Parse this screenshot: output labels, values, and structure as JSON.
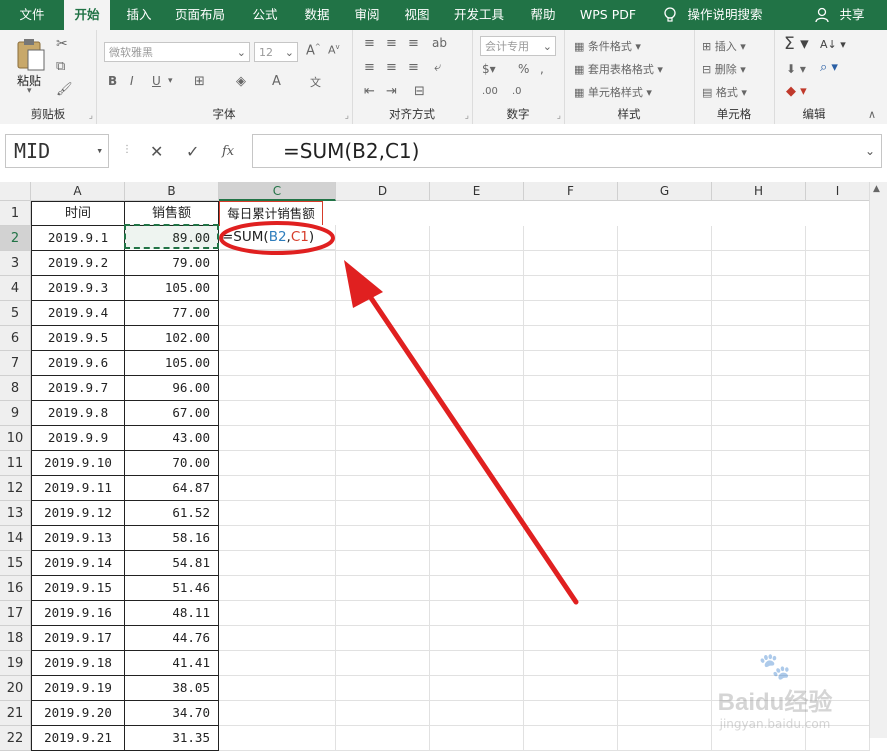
{
  "tabs": [
    {
      "label": "文件"
    },
    {
      "label": "开始",
      "active": true
    },
    {
      "label": "插入"
    },
    {
      "label": "页面布局"
    },
    {
      "label": "公式"
    },
    {
      "label": "数据"
    },
    {
      "label": "审阅"
    },
    {
      "label": "视图"
    },
    {
      "label": "开发工具"
    },
    {
      "label": "帮助"
    },
    {
      "label": "WPS PDF"
    },
    {
      "label": "操作说明搜索"
    }
  ],
  "share_label": "共享",
  "ribbon": {
    "clipboard": {
      "label": "剪贴板",
      "paste_label": "粘贴"
    },
    "font": {
      "label": "字体",
      "font_name": "微软雅黑",
      "font_size": "12",
      "bold": "B",
      "italic": "I",
      "underline": "U",
      "font_color": "A"
    },
    "alignment": {
      "label": "对齐方式"
    },
    "number": {
      "label": "数字",
      "format": "会计专用"
    },
    "styles": {
      "label": "样式",
      "cond_format": "条件格式",
      "table_format": "套用表格格式",
      "cell_style": "单元格样式"
    },
    "cells": {
      "label": "单元格",
      "insert": "插入",
      "delete": "删除",
      "format": "格式"
    },
    "editing": {
      "label": "编辑"
    }
  },
  "formula_bar": {
    "name_box": "MID",
    "formula": "=SUM(B2,C1)",
    "cancel": "✕",
    "confirm": "✓",
    "fx": "fx"
  },
  "columns": [
    "A",
    "B",
    "C",
    "D",
    "E",
    "F",
    "G",
    "H",
    "I"
  ],
  "headers": {
    "a": "时间",
    "b": "销售额",
    "c": "每日累计销售额"
  },
  "rows": [
    {
      "r": "2",
      "a": "2019.9.1",
      "b": "89.00"
    },
    {
      "r": "3",
      "a": "2019.9.2",
      "b": "79.00"
    },
    {
      "r": "4",
      "a": "2019.9.3",
      "b": "105.00"
    },
    {
      "r": "5",
      "a": "2019.9.4",
      "b": "77.00"
    },
    {
      "r": "6",
      "a": "2019.9.5",
      "b": "102.00"
    },
    {
      "r": "7",
      "a": "2019.9.6",
      "b": "105.00"
    },
    {
      "r": "8",
      "a": "2019.9.7",
      "b": "96.00"
    },
    {
      "r": "9",
      "a": "2019.9.8",
      "b": "67.00"
    },
    {
      "r": "10",
      "a": "2019.9.9",
      "b": "43.00"
    },
    {
      "r": "11",
      "a": "2019.9.10",
      "b": "70.00"
    },
    {
      "r": "12",
      "a": "2019.9.11",
      "b": "64.87"
    },
    {
      "r": "13",
      "a": "2019.9.12",
      "b": "61.52"
    },
    {
      "r": "14",
      "a": "2019.9.13",
      "b": "58.16"
    },
    {
      "r": "15",
      "a": "2019.9.14",
      "b": "54.81"
    },
    {
      "r": "16",
      "a": "2019.9.15",
      "b": "51.46"
    },
    {
      "r": "17",
      "a": "2019.9.16",
      "b": "48.11"
    },
    {
      "r": "18",
      "a": "2019.9.17",
      "b": "44.76"
    },
    {
      "r": "19",
      "a": "2019.9.18",
      "b": "41.41"
    },
    {
      "r": "20",
      "a": "2019.9.19",
      "b": "38.05"
    },
    {
      "r": "21",
      "a": "2019.9.20",
      "b": "34.70"
    },
    {
      "r": "22",
      "a": "2019.9.21",
      "b": "31.35"
    }
  ],
  "editing_cell": {
    "prefix": "=SUM(",
    "ref1": "B2",
    "sep": ",",
    "ref2": "C1",
    "suffix": ")"
  },
  "colors": {
    "accent": "#217346",
    "ref1": "#2f7ebd",
    "ref2": "#d63c2a",
    "annotation": "#e02020"
  },
  "watermark": {
    "brand": "Baidu经验",
    "url": "jingyan.baidu.com"
  }
}
